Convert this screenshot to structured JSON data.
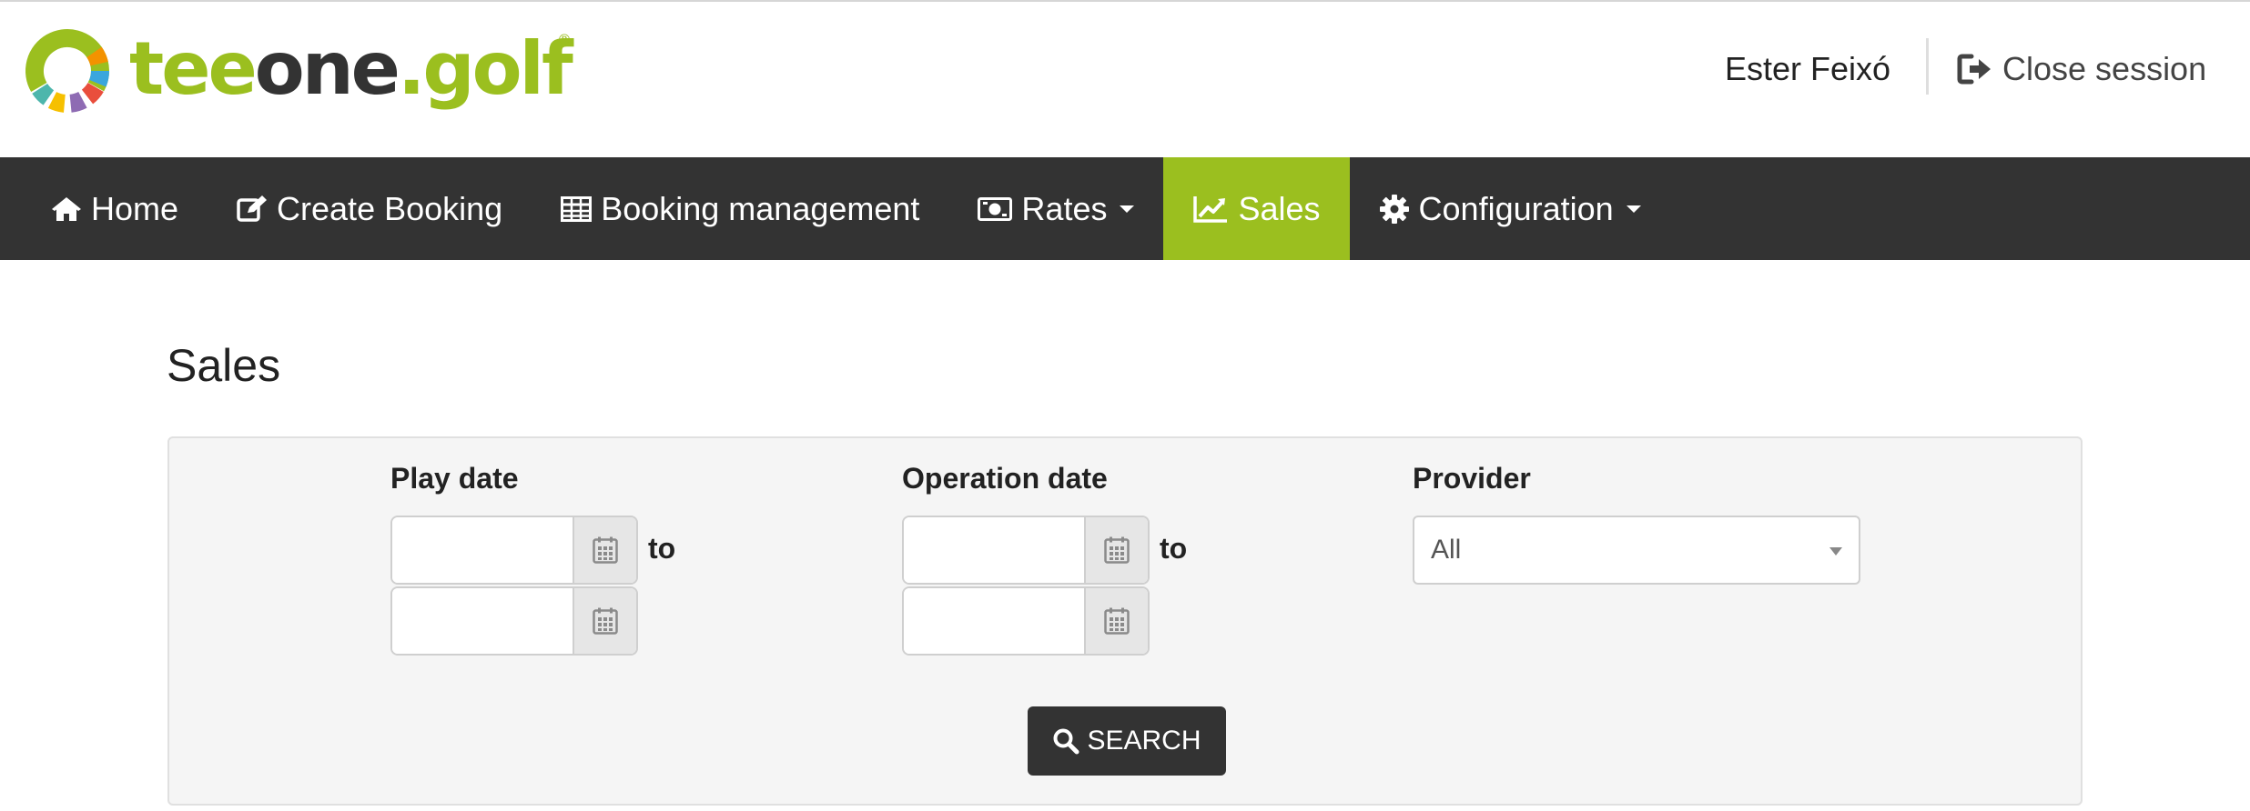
{
  "header": {
    "logo": {
      "part1": "tee",
      "part2": "one",
      "part3": ".golf",
      "reg": "®"
    },
    "user_name": "Ester Feixó",
    "close_session": "Close session"
  },
  "nav": {
    "items": [
      {
        "label": "Home",
        "icon": "home-icon"
      },
      {
        "label": "Create Booking",
        "icon": "edit-icon"
      },
      {
        "label": "Booking management",
        "icon": "table-icon"
      },
      {
        "label": "Rates",
        "icon": "money-icon",
        "dropdown": true
      },
      {
        "label": "Sales",
        "icon": "line-chart-icon",
        "active": true
      },
      {
        "label": "Configuration",
        "icon": "gear-icon",
        "dropdown": true
      }
    ]
  },
  "page": {
    "title": "Sales"
  },
  "filters": {
    "play_date": {
      "label": "Play date",
      "from_value": "",
      "to_value": "",
      "to_label": "to"
    },
    "operation_date": {
      "label": "Operation date",
      "from_value": "",
      "to_value": "",
      "to_label": "to"
    },
    "provider": {
      "label": "Provider",
      "selected": "All"
    },
    "search_label": "SEARCH"
  },
  "colors": {
    "brand_green": "#9bbf1f",
    "nav_bg": "#333333",
    "panel_bg": "#f5f5f5"
  }
}
